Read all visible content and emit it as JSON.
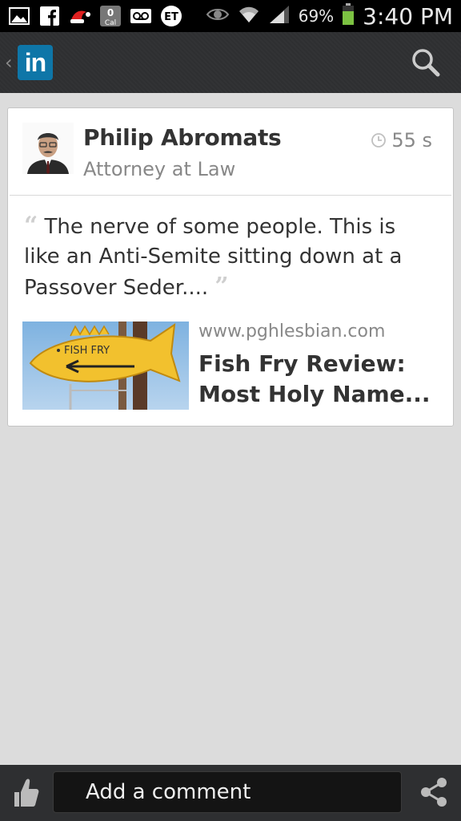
{
  "status_bar": {
    "battery_percent": "69%",
    "time": "3:40 PM",
    "calendar_badge": "0",
    "calendar_label": "Cal",
    "et_label": "ET"
  },
  "app_bar": {
    "logo_text": "in"
  },
  "post": {
    "author_name": "Philip Abromats",
    "author_headline": "Attorney at Law",
    "age": "55 s",
    "text": "The nerve of some people.  This is like an Anti-Semite sitting down at a Passover Seder....",
    "link": {
      "domain": "www.pghlesbian.com",
      "title_line1": "Fish Fry Review:",
      "title_line2": "Most Holy Name...",
      "thumbnail_sign_text": "FISH FRY"
    }
  },
  "bottom_bar": {
    "comment_placeholder": "Add a comment"
  },
  "colors": {
    "linkedin_blue": "#0e76a8",
    "battery_green": "#7cc242",
    "app_bar": "#2e2f31"
  }
}
